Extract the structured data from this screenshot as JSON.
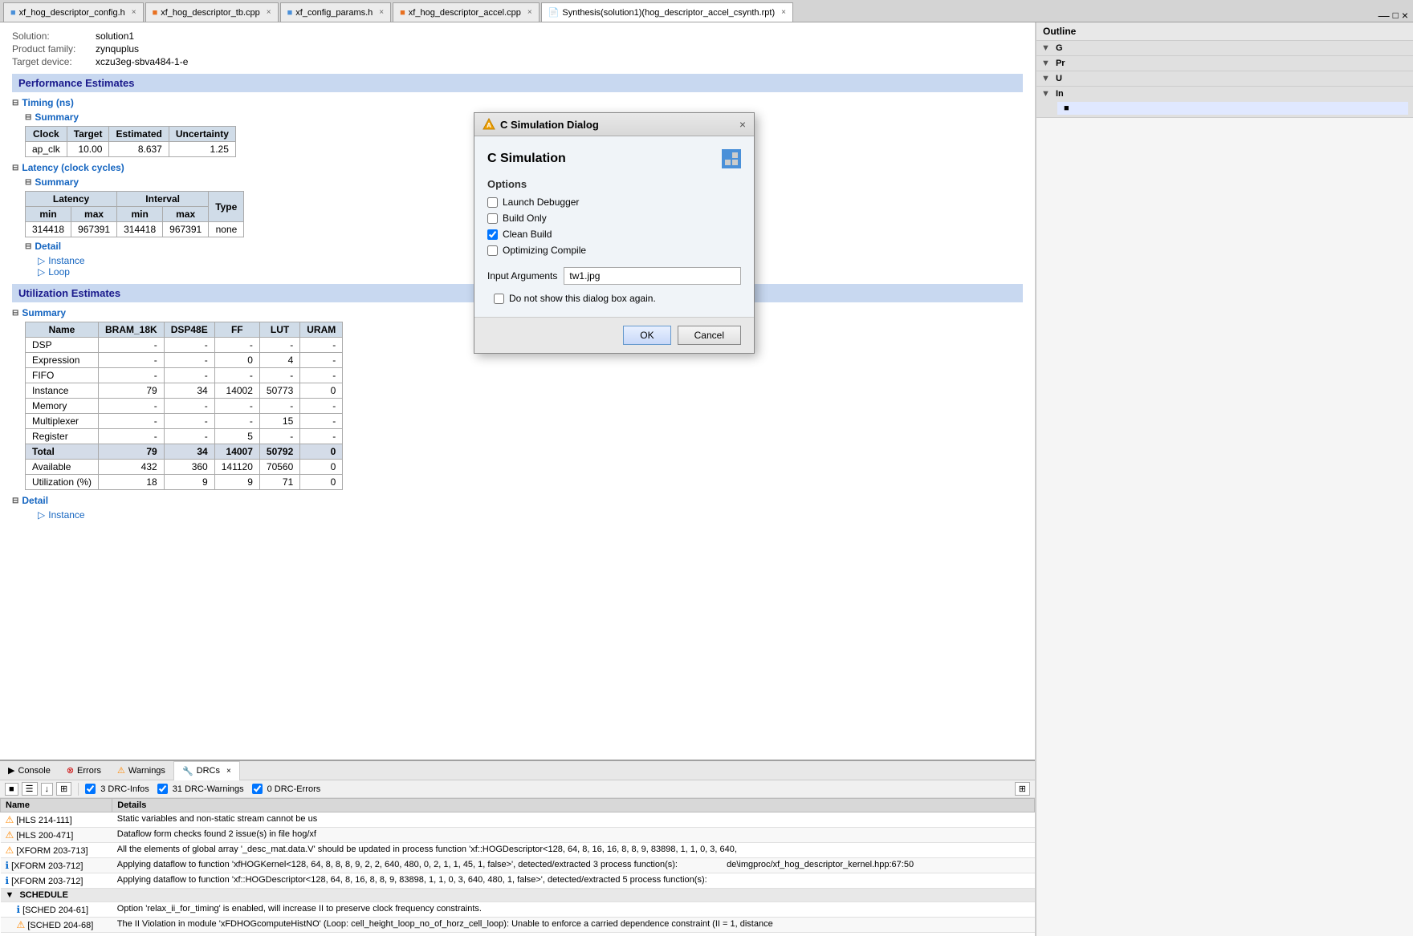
{
  "tabs": [
    {
      "id": "tab1",
      "label": "xf_hog_descriptor_config.h",
      "active": false,
      "icon": "h-file"
    },
    {
      "id": "tab2",
      "label": "xf_hog_descriptor_tb.cpp",
      "active": false,
      "icon": "cpp-file"
    },
    {
      "id": "tab3",
      "label": "xf_config_params.h",
      "active": false,
      "icon": "h-file"
    },
    {
      "id": "tab4",
      "label": "xf_hog_descriptor_accel.cpp",
      "active": false,
      "icon": "cpp-file"
    },
    {
      "id": "tab5",
      "label": "Synthesis(solution1)(hog_descriptor_accel_csynth.rpt)",
      "active": true,
      "icon": "rpt-file"
    }
  ],
  "report": {
    "solution_label": "Solution:",
    "solution_value": "solution1",
    "product_family_label": "Product family:",
    "product_family_value": "zynquplus",
    "target_device_label": "Target device:",
    "target_device_value": "xczu3eg-sbva484-1-e",
    "performance_header": "Performance Estimates",
    "timing_header": "Timing (ns)",
    "summary_label": "Summary",
    "timing_columns": [
      "Clock",
      "Target",
      "Estimated",
      "Uncertainty"
    ],
    "timing_rows": [
      {
        "clock": "ap_clk",
        "target": "10.00",
        "estimated": "8.637",
        "uncertainty": "1.25"
      }
    ],
    "latency_header": "Latency (clock cycles)",
    "latency_summary": "Summary",
    "latency_columns_group1": "Latency",
    "latency_columns_group2": "Interval",
    "latency_sub_cols": [
      "min",
      "max",
      "min",
      "max",
      "Type"
    ],
    "latency_rows": [
      {
        "lat_min": "314418",
        "lat_max": "967391",
        "int_min": "314418",
        "int_max": "967391",
        "type": "none"
      }
    ],
    "detail_label": "Detail",
    "instance_label": "Instance",
    "loop_label": "Loop",
    "utilization_header": "Utilization Estimates",
    "util_summary": "Summary",
    "util_columns": [
      "Name",
      "BRAM_18K",
      "DSP48E",
      "FF",
      "LUT",
      "URAM"
    ],
    "util_rows": [
      {
        "name": "DSP",
        "bram": "-",
        "dsp": "-",
        "ff": "-",
        "lut": "-",
        "uram": "-"
      },
      {
        "name": "Expression",
        "bram": "-",
        "dsp": "-",
        "ff": "0",
        "lut": "4",
        "uram": "-"
      },
      {
        "name": "FIFO",
        "bram": "-",
        "dsp": "-",
        "ff": "-",
        "lut": "-",
        "uram": "-"
      },
      {
        "name": "Instance",
        "bram": "79",
        "dsp": "34",
        "ff": "14002",
        "lut": "50773",
        "uram": "0"
      },
      {
        "name": "Memory",
        "bram": "-",
        "dsp": "-",
        "ff": "-",
        "lut": "-",
        "uram": "-"
      },
      {
        "name": "Multiplexer",
        "bram": "-",
        "dsp": "-",
        "ff": "-",
        "lut": "15",
        "uram": "-"
      },
      {
        "name": "Register",
        "bram": "-",
        "dsp": "-",
        "ff": "5",
        "lut": "-",
        "uram": "-"
      }
    ],
    "util_total": {
      "name": "Total",
      "bram": "79",
      "dsp": "34",
      "ff": "14007",
      "lut": "50792",
      "uram": "0"
    },
    "util_available": {
      "name": "Available",
      "bram": "432",
      "dsp": "360",
      "ff": "141120",
      "lut": "70560",
      "uram": "0"
    },
    "util_pct": {
      "name": "Utilization (%)",
      "bram": "18",
      "dsp": "9",
      "ff": "9",
      "lut": "71",
      "uram": "0"
    },
    "detail_label2": "Detail",
    "instance_label2": "Instance"
  },
  "dialog": {
    "title": "C Simulation Dialog",
    "subtitle": "C Simulation",
    "options_label": "Options",
    "launch_debugger": "Launch Debugger",
    "build_only": "Build Only",
    "clean_build": "Clean Build",
    "optimizing_compile": "Optimizing Compile",
    "launch_debugger_checked": false,
    "build_only_checked": false,
    "clean_build_checked": true,
    "optimizing_compile_checked": false,
    "input_args_label": "Input Arguments",
    "input_args_value": "tw1.jpg",
    "no_show_label": "Do not show this dialog box again.",
    "no_show_checked": false,
    "ok_label": "OK",
    "cancel_label": "Cancel"
  },
  "bottom_panel": {
    "tabs": [
      {
        "label": "Console",
        "icon": "console-icon"
      },
      {
        "label": "Errors",
        "icon": "error-icon",
        "badge": ""
      },
      {
        "label": "Warnings",
        "icon": "warning-icon"
      },
      {
        "label": "DRCs",
        "icon": "drc-icon",
        "active": true
      }
    ],
    "filter_drc_infos": "3 DRC-Infos",
    "filter_drc_warnings": "31 DRC-Warnings",
    "filter_drc_errors": "0 DRC-Errors",
    "columns": [
      "Name",
      "Details"
    ],
    "rows": [
      {
        "type": "warning",
        "name": "[HLS 214-111]",
        "details": "Static variables and non-static stream cannot be us"
      },
      {
        "type": "warning",
        "name": "[HLS 200-471]",
        "details": "Dataflow form checks found 2 issue(s) in file hog/xf"
      },
      {
        "type": "warning",
        "name": "[XFORM 203-713]",
        "details": "All the elements of global array '_desc_mat.data.V' should be updated in process function 'xf::HOGDescriptor<128, 64, 8, 16, 16, 8, 8, 9, 83898, 1, 1, 0, 3, 640,"
      },
      {
        "type": "info",
        "name": "[XFORM 203-712]",
        "details": "Applying dataflow to function 'xfHOGKernel<128, 64, 8, 8, 8, 9, 2, 2, 640, 480, 0, 2, 1, 1, 45, 1, false>', detected/extracted 3 process function(s):"
      },
      {
        "type": "info",
        "name": "[XFORM 203-712]",
        "details": "Applying dataflow to function 'xf::HOGDescriptor<128, 64, 8, 16, 8, 8, 9, 83898, 1, 1, 0, 3, 640, 480, 1, false>', detected/extracted 5 process function(s):"
      },
      {
        "type": "group",
        "name": "SCHEDULE",
        "details": ""
      },
      {
        "type": "info",
        "name": "[SCHED 204-61]",
        "details": "Option 'relax_ii_for_timing' is enabled, will increase II to preserve clock frequency constraints."
      },
      {
        "type": "warning",
        "name": "[SCHED 204-68]",
        "details": "The II Violation in module 'xFDHOGcomputeHistNO' (Loop: cell_height_loop_no_of_horz_cell_loop): Unable to enforce a carried dependence constraint (II = 1, distance"
      }
    ],
    "detail_suffix": "de\\imgproc/xf_hog_descriptor_kernel.hpp:67:50"
  },
  "right_panel": {
    "header": "Outline",
    "sections": [
      {
        "label": "G",
        "items": []
      },
      {
        "label": "Pr",
        "items": []
      },
      {
        "label": "U",
        "items": []
      },
      {
        "label": "In",
        "items": []
      }
    ]
  }
}
